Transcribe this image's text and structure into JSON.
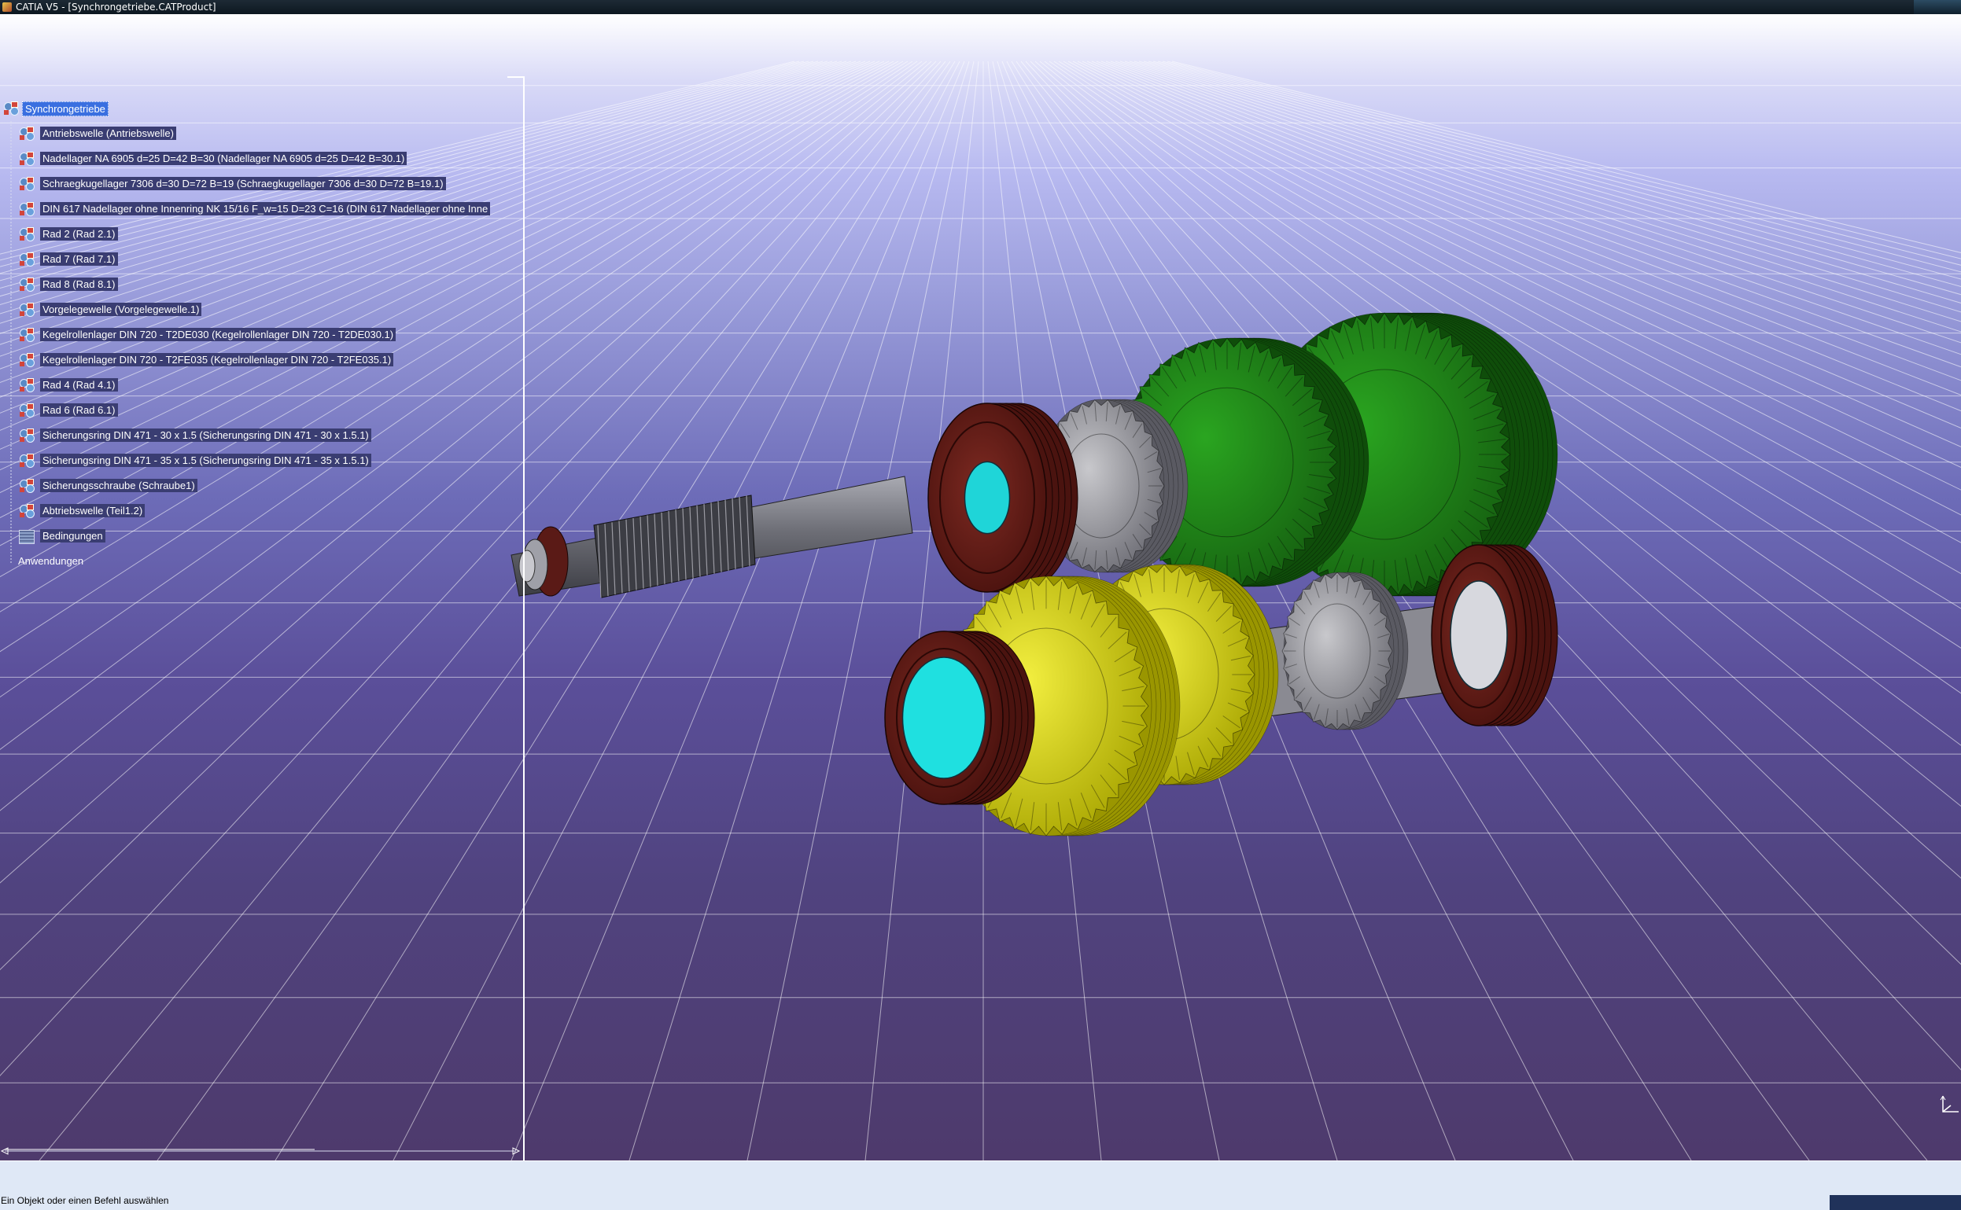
{
  "window": {
    "title": "CATIA V5 - [Synchrongetriebe.CATProduct]"
  },
  "tree": {
    "root": "Synchrongetriebe",
    "items": [
      {
        "label": "Antriebswelle (Antriebswelle)",
        "icon": "part-instance-icon"
      },
      {
        "label": "Nadellager NA 6905 d=25 D=42 B=30 (Nadellager NA 6905 d=25 D=42 B=30.1)",
        "icon": "part-instance-icon"
      },
      {
        "label": "Schraegkugellager 7306 d=30 D=72 B=19 (Schraegkugellager 7306 d=30 D=72 B=19.1)",
        "icon": "part-instance-icon"
      },
      {
        "label": "DIN 617 Nadellager ohne Innenring NK 15/16 F_w=15 D=23 C=16 (DIN 617 Nadellager ohne Inne",
        "icon": "part-instance-icon"
      },
      {
        "label": "Rad 2 (Rad 2.1)",
        "icon": "part-instance-icon"
      },
      {
        "label": "Rad 7 (Rad 7.1)",
        "icon": "part-instance-icon"
      },
      {
        "label": "Rad 8 (Rad 8.1)",
        "icon": "part-instance-icon"
      },
      {
        "label": "Vorgelegewelle (Vorgelegewelle.1)",
        "icon": "part-instance-icon"
      },
      {
        "label": "Kegelrollenlager DIN 720 - T2DE030 (Kegelrollenlager DIN 720 - T2DE030.1)",
        "icon": "part-instance-icon"
      },
      {
        "label": "Kegelrollenlager DIN 720 - T2FE035 (Kegelrollenlager DIN 720 - T2FE035.1)",
        "icon": "part-instance-icon"
      },
      {
        "label": "Rad 4 (Rad 4.1)",
        "icon": "part-instance-icon"
      },
      {
        "label": "Rad 6 (Rad 6.1)",
        "icon": "part-instance-icon"
      },
      {
        "label": "Sicherungsring DIN 471 - 30 x 1.5 (Sicherungsring DIN 471 - 30 x 1.5.1)",
        "icon": "part-instance-icon"
      },
      {
        "label": "Sicherungsring DIN 471 - 35 x 1.5 (Sicherungsring DIN 471 - 35 x 1.5.1)",
        "icon": "part-instance-icon"
      },
      {
        "label": "Sicherungsschraube (Schraube1)",
        "icon": "part-instance-icon"
      },
      {
        "label": "Abtriebswelle (Teil1.2)",
        "icon": "part-instance-icon"
      },
      {
        "label": "Bedingungen",
        "icon": "constraints-icon"
      }
    ],
    "applications": "Anwendungen"
  },
  "status": {
    "text": "Ein Objekt oder einen Befehl auswählen"
  },
  "colors": {
    "gear_green": "#1f8a1a",
    "gear_yellow": "#e6e200",
    "bearing_brown": "#5a1a16",
    "shaft_gray": "#7d7e85",
    "bore_cyan": "#19e0e0",
    "tree_selection": "#3a6fe0"
  }
}
